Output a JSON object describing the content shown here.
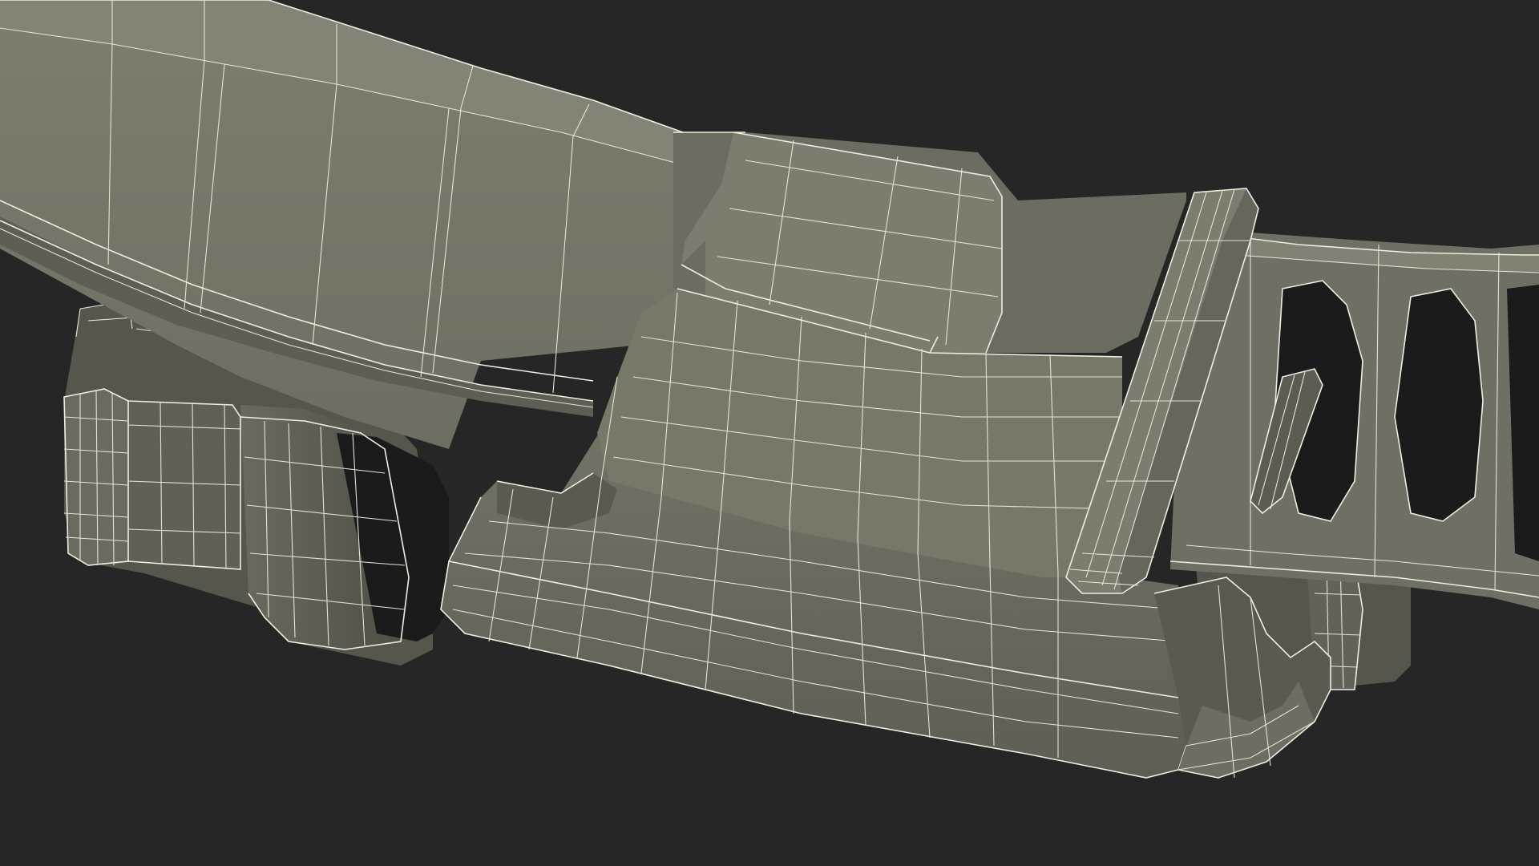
{
  "scene": {
    "subject": "wireframe-buckle-strap",
    "colors": {
      "background": "#262626",
      "surface_light": "#7b7b6d",
      "surface_mid": "#6c6c60",
      "surface_dark": "#55554b",
      "shadow": "#161616",
      "wire": "#e6e3d2"
    }
  }
}
